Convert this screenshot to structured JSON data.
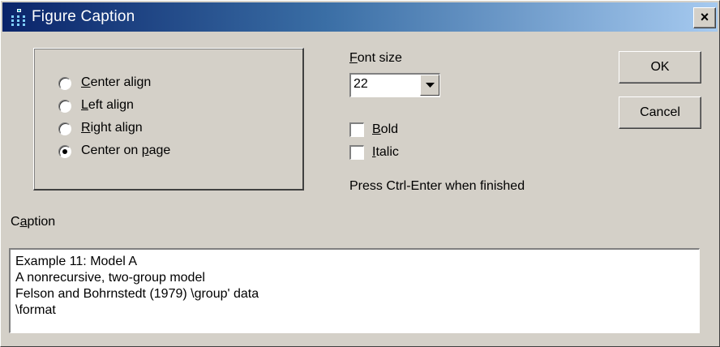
{
  "window": {
    "title": "Figure Caption",
    "close_label": "×"
  },
  "alignment": {
    "options": [
      {
        "before": "",
        "mnemonic": "C",
        "after": "enter align",
        "selected": false
      },
      {
        "before": "",
        "mnemonic": "L",
        "after": "eft align",
        "selected": false
      },
      {
        "before": "",
        "mnemonic": "R",
        "after": "ight align",
        "selected": false
      },
      {
        "before": "Center on ",
        "mnemonic": "p",
        "after": "age",
        "selected": true
      }
    ]
  },
  "font_size": {
    "label_mnemonic": "F",
    "label_rest": "ont size",
    "value": "22"
  },
  "style": {
    "bold": {
      "mnemonic": "B",
      "rest": "old",
      "checked": false
    },
    "italic": {
      "mnemonic": "I",
      "rest": "talic",
      "checked": false
    }
  },
  "hint": "Press Ctrl-Enter when finished",
  "caption": {
    "label_before": "C",
    "label_mnemonic": "a",
    "label_after": "ption",
    "text": "Example 11: Model A\nA nonrecursive, two-group model\nFelson and Bohrnstedt (1979) \\group' data\n\\format"
  },
  "buttons": {
    "ok": "OK",
    "cancel": "Cancel"
  }
}
